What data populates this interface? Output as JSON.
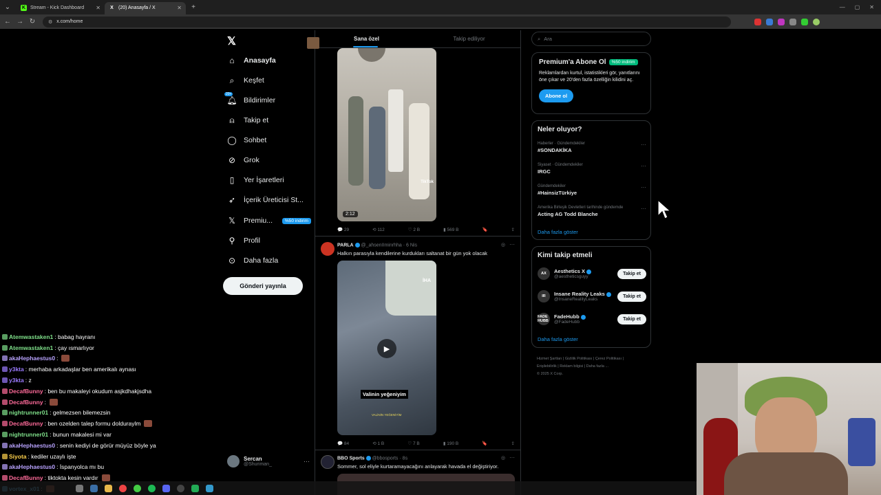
{
  "browser": {
    "tabs": [
      {
        "title": "Stream - Kick Dashboard",
        "active": false,
        "favicon": "K"
      },
      {
        "title": "(20) Anasayfa / X",
        "active": true,
        "favicon": "X"
      }
    ],
    "url": "x.com/home"
  },
  "nav": {
    "items": [
      {
        "label": "Anasayfa",
        "icon": "home-icon"
      },
      {
        "label": "Keşfet",
        "icon": "search-icon"
      },
      {
        "label": "Bildirimler",
        "icon": "bell-icon",
        "badge": "20+"
      },
      {
        "label": "Takip et",
        "icon": "person-plus-icon"
      },
      {
        "label": "Sohbet",
        "icon": "chat-icon"
      },
      {
        "label": "Grok",
        "icon": "grok-icon"
      },
      {
        "label": "Yer İşaretleri",
        "icon": "bookmark-icon"
      },
      {
        "label": "İçerik Üreticisi St...",
        "icon": "rocket-icon"
      },
      {
        "label": "Premiu...",
        "icon": "x-icon",
        "badge": "%50 indirim"
      },
      {
        "label": "Profil",
        "icon": "person-icon"
      },
      {
        "label": "Daha fazla",
        "icon": "more-circle-icon"
      }
    ],
    "post_button": "Gönderi yayınla",
    "profile": {
      "name": "Sercan",
      "handle": "@Shuriman_"
    }
  },
  "feed": {
    "tabs": [
      "Sana özel",
      "Takip ediliyor"
    ],
    "post1": {
      "video_duration": "2:12",
      "watermark": "TikTok",
      "actions": {
        "replies": "29",
        "reposts": "112",
        "likes": "2 B",
        "views": "569 B"
      }
    },
    "post2": {
      "author": "PARLA",
      "handle": "@_ahsenIIminrhha",
      "time": "6 Nis",
      "text": "Halkın parasıyla kendilerine kurdukları saltanat bir gün yok olacak",
      "caption": "Valinin yeğeniyim",
      "caption_small": "VALİNİN YEĞENİYİM",
      "watermark": "İHA",
      "actions": {
        "replies": "84",
        "reposts": "1 B",
        "likes": "7 B",
        "views": "190 B"
      }
    },
    "post3": {
      "author": "BBO Sports",
      "handle": "@bbosports",
      "time": "8s",
      "text": "Sommer, sol eliyle kurtaramayacağını anlayarak havada el değiştiriyor."
    }
  },
  "right": {
    "search_placeholder": "Ara",
    "premium": {
      "title": "Premium'a Abone Ol",
      "badge": "%50 indirim",
      "text": "Reklamlardan kurtul, istatistikleri gör, yanıtlarını öne çıkar ve 20'den fazla özelliğin kilidini aç.",
      "button": "Abone ol"
    },
    "trends": {
      "title": "Neler oluyor?",
      "items": [
        {
          "category": "Haberler · Gündemdekiler",
          "title": "#SONDAKİKA"
        },
        {
          "category": "Siyaset · Gündemdekiler",
          "title": "IRGC"
        },
        {
          "category": "Gündemdekiler",
          "title": "#HainsizTürkiye"
        },
        {
          "category": "Amerika Birleşik Devletleri tarihinde gündemde",
          "title": "Acting AG Todd Blanche"
        }
      ],
      "more": "Daha fazla göster"
    },
    "who_to_follow": {
      "title": "Kimi takip etmeli",
      "items": [
        {
          "name": "Aesthetics X",
          "handle": "@aestheticsguyy",
          "button": "Takip et",
          "avatar": "AX"
        },
        {
          "name": "Insane Reality Leaks",
          "handle": "@InsaneRealityLeaks",
          "button": "Takip et",
          "avatar": "IR"
        },
        {
          "name": "FadeHubb",
          "handle": "@FadeHubb",
          "button": "Takip et",
          "avatar": "FADE HUBB"
        }
      ],
      "more": "Daha fazla göster"
    },
    "footer": {
      "line1": [
        "Hizmet Şartları",
        "Gizlilik Politikası",
        "Çerez Politikası"
      ],
      "line2": [
        "Erişilebilirlik",
        "Reklam bilgisi",
        "Daha fazla ..."
      ],
      "copyright": "© 2025 X Corp."
    }
  },
  "chat": {
    "messages": [
      {
        "user": "Atemwastaken1",
        "text": ": babag hayranı",
        "color": "#7fe08a"
      },
      {
        "user": "Atemwastaken1",
        "text": ": çay ısmarlıyor",
        "color": "#7fe08a"
      },
      {
        "user": "akaHephaestus0",
        "text": ":",
        "color": "#b9a3ff",
        "emote": true
      },
      {
        "user": "y3kta",
        "text": ": merhaba arkadaşlar ben amerikalı aynası",
        "color": "#9b7bff"
      },
      {
        "user": "y3kta",
        "text": ": z",
        "color": "#9b7bff"
      },
      {
        "user": "DecafBunny",
        "text": ": ben bu makaleyi okudum asjkdhakjsdha",
        "color": "#ff6b9a"
      },
      {
        "user": "DecafBunny",
        "text": ":",
        "color": "#ff6b9a",
        "emote": true
      },
      {
        "user": "nightrunner01",
        "text": ": gelmezsen bilemezsin",
        "color": "#7fe08a"
      },
      {
        "user": "DecafBunny",
        "text": ": ben ozelden talep formu dolduraylm",
        "color": "#ff6b9a",
        "emote": true
      },
      {
        "user": "nightrunner01",
        "text": ": bunun makalesi mi var",
        "color": "#7fe08a"
      },
      {
        "user": "akaHephaestus0",
        "text": ": senin kediyi de görür müyüz böyle ya",
        "color": "#b9a3ff"
      },
      {
        "user": "Siyota",
        "text": ": kediler uzaylı işte",
        "color": "#ffd24d"
      },
      {
        "user": "akaHephaestus0",
        "text": ": İspanyolca mı bu",
        "color": "#b9a3ff"
      },
      {
        "user": "DecafBunny",
        "text": ": tiktokta kesin vardır",
        "color": "#ff6b9a",
        "emote": true
      },
      {
        "user": "vortex_x01",
        "text": ":",
        "color": "#66c7ff",
        "emote": true
      }
    ]
  },
  "colors": {
    "accent": "#1d9bf0",
    "premium_badge": "#00ba7c",
    "background": "#000000"
  }
}
